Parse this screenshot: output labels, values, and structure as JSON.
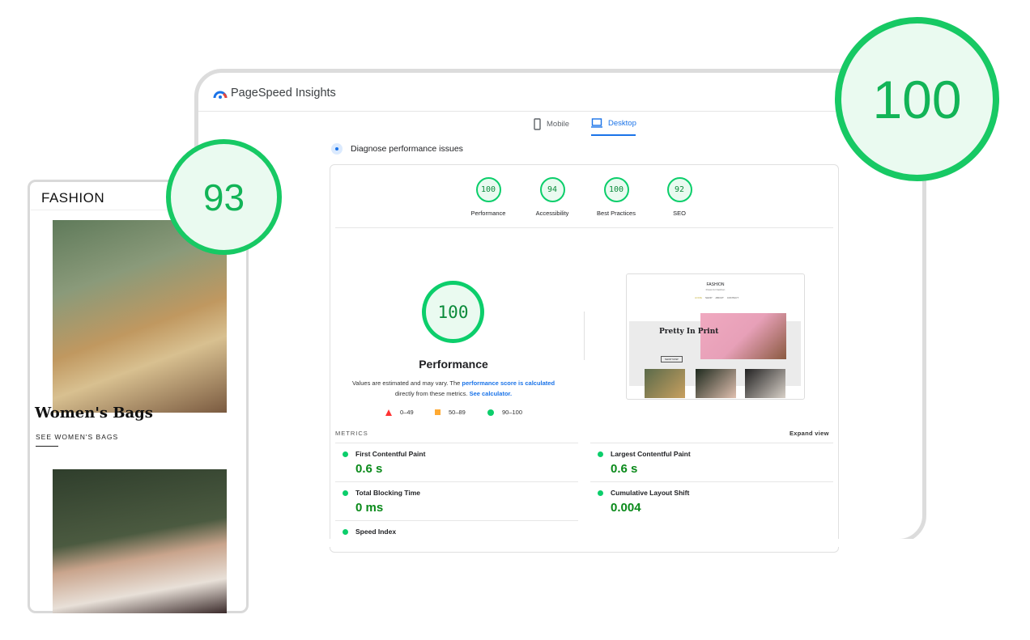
{
  "app": {
    "title": "PageSpeed Insights"
  },
  "tabs": [
    {
      "label": "Mobile",
      "icon": "phone-icon"
    },
    {
      "label": "Desktop",
      "icon": "laptop-icon",
      "active": true
    }
  ],
  "diagnose": "Diagnose performance issues",
  "categories": [
    {
      "label": "Performance",
      "score": "100"
    },
    {
      "label": "Accessibility",
      "score": "94"
    },
    {
      "label": "Best Practices",
      "score": "100"
    },
    {
      "label": "SEO",
      "score": "92"
    }
  ],
  "performance": {
    "score": "100",
    "title": "Performance",
    "note_prefix": "Values are estimated and may vary. The ",
    "note_link": "performance score is calculated",
    "note_mid": " directly from these metrics. ",
    "note_link2": "See calculator."
  },
  "legend": [
    {
      "range": "0–49",
      "color": "#ff3333"
    },
    {
      "range": "50–89",
      "color": "#ffaa33"
    },
    {
      "range": "90–100",
      "color": "#0cce6b"
    }
  ],
  "metrics": {
    "label": "METRICS",
    "expand": "Expand view",
    "items": [
      {
        "name": "First Contentful Paint",
        "value": "0.6 s"
      },
      {
        "name": "Largest Contentful Paint",
        "value": "0.6 s"
      },
      {
        "name": "Total Blocking Time",
        "value": "0 ms"
      },
      {
        "name": "Cumulative Layout Shift",
        "value": "0.004"
      },
      {
        "name": "Speed Index",
        "value": ""
      }
    ]
  },
  "thumbnail": {
    "brand": "FASHION",
    "tagline": "Dress for Fashion",
    "nav": [
      "HOME",
      "SHOP",
      "ABOUT",
      "CONTACT"
    ],
    "hero": "Pretty In Print",
    "button": "SHOP NOW"
  },
  "desktop_badge": "100",
  "mobile": {
    "brand": "FASHION",
    "badge": "93",
    "section_title": "Women's Bags",
    "section_link": "SEE WOMEN'S BAGS"
  },
  "colors": {
    "pass": "#0cce6b",
    "link": "#1a73e8"
  }
}
